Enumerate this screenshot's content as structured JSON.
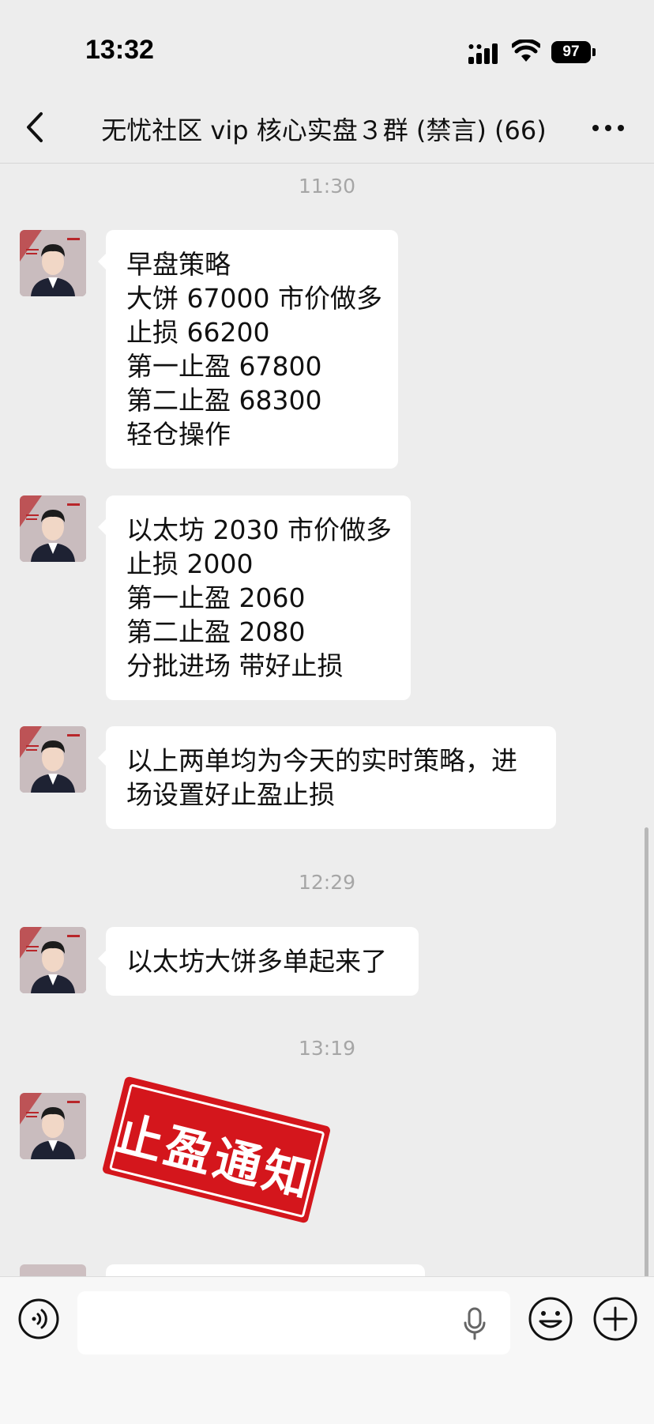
{
  "status_bar": {
    "time": "13:32",
    "battery": "97",
    "signal_icon": "cellular-signal-icon",
    "wifi_icon": "wifi-icon"
  },
  "nav": {
    "title": "无忧社区 vip 核心实盘３群 (禁言) (66)",
    "back_icon": "chevron-left-icon",
    "more_icon": "more-dots-icon"
  },
  "chat": {
    "timestamps": [
      "11:30",
      "12:29",
      "13:19"
    ],
    "messages": [
      {
        "lines": [
          "早盘策略",
          "大饼 67000 市价做多",
          "止损 66200",
          "第一止盈 67800",
          "第二止盈 68300",
          "轻仓操作"
        ]
      },
      {
        "lines": [
          "以太坊 2030 市价做多",
          "止损 2000",
          "第一止盈 2060",
          "第二止盈 2080",
          "分批进场 带好止损"
        ]
      },
      {
        "lines": [
          "以上两单均为今天的实时策略，进",
          "场设置好止盈止损"
        ]
      },
      {
        "lines": [
          "以太坊大饼多单起来了"
        ]
      }
    ],
    "sticker_text": "止盈通知"
  },
  "input_bar": {
    "voice_icon": "voice-mode-icon",
    "text_value": "",
    "mic_icon": "microphone-icon",
    "emoji_icon": "emoji-icon",
    "plus_icon": "plus-icon"
  },
  "colors": {
    "background": "#ededed",
    "bubble": "#ffffff",
    "timestamp": "#a6a6a6",
    "sticker_red": "#d4161c"
  }
}
